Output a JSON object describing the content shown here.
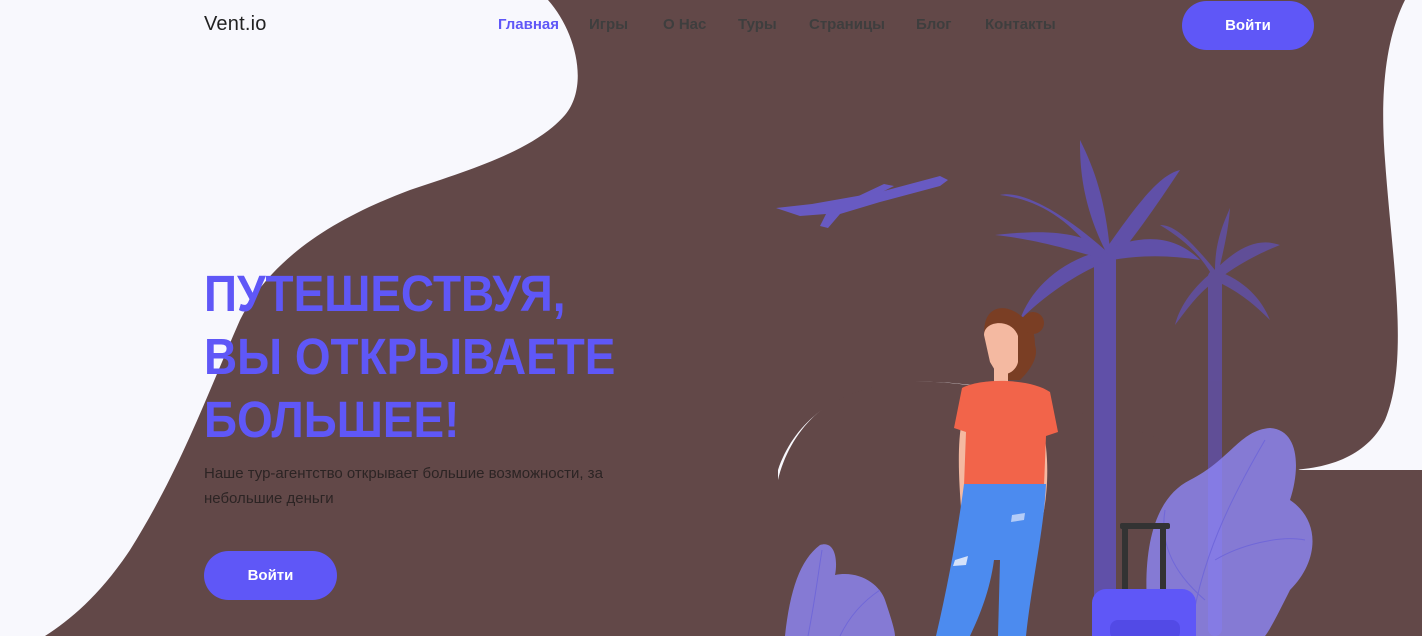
{
  "header": {
    "logo": "Vent.io",
    "nav": [
      {
        "label": "Главная",
        "active": true
      },
      {
        "label": "Игры",
        "active": false
      },
      {
        "label": "О Нас",
        "active": false
      },
      {
        "label": "Туры",
        "active": false
      },
      {
        "label": "Страницы",
        "active": false
      },
      {
        "label": "Блог",
        "active": false
      },
      {
        "label": "Контакты",
        "active": false
      }
    ],
    "login_label": "Войти"
  },
  "hero": {
    "title": "ПУТЕШЕСТВУЯ, ВЫ ОТКРЫВАЕТЕ БОЛЬШЕЕ!",
    "description": "Наше тур-агентство открывает большие возможности, за небольшие деньги",
    "cta_label": "Войти"
  },
  "illustration": {
    "icons": [
      "airplane-icon",
      "palm-tree-icon",
      "traveler-woman-icon",
      "suitcase-icon",
      "leaf-icon"
    ]
  },
  "colors": {
    "accent": "#5f57f7",
    "blob": "#624848",
    "page_background": "#f8f8fd",
    "text_dark": "#2c2424"
  }
}
